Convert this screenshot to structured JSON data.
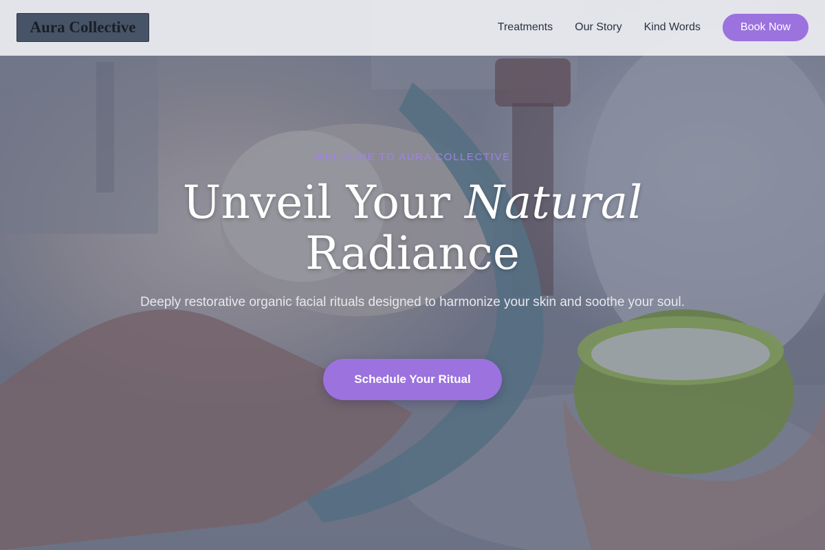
{
  "brand": {
    "name": "Aura Collective"
  },
  "nav": {
    "items": [
      {
        "label": "Treatments"
      },
      {
        "label": "Our Story"
      },
      {
        "label": "Kind Words"
      }
    ],
    "book_label": "Book Now"
  },
  "hero": {
    "eyebrow": "WELCOME TO AURA COLLECTIVE",
    "headline_part1": "Unveil Your ",
    "headline_emphasis": "Natural",
    "headline_line2": "Radiance",
    "subtitle": "Deeply restorative organic facial rituals designed to harmonize your skin and soothe your soul.",
    "cta_label": "Schedule Your Ritual",
    "background_alt": "Woman receiving a cream facial mask treatment with a towel headband while a hand holds a green bowl of cream"
  },
  "colors": {
    "accent": "#9b72de",
    "eyebrow": "#a082e6",
    "logo_bg": "#475366",
    "nav_text": "#2b3140",
    "header_bg": "#ecedf1"
  }
}
